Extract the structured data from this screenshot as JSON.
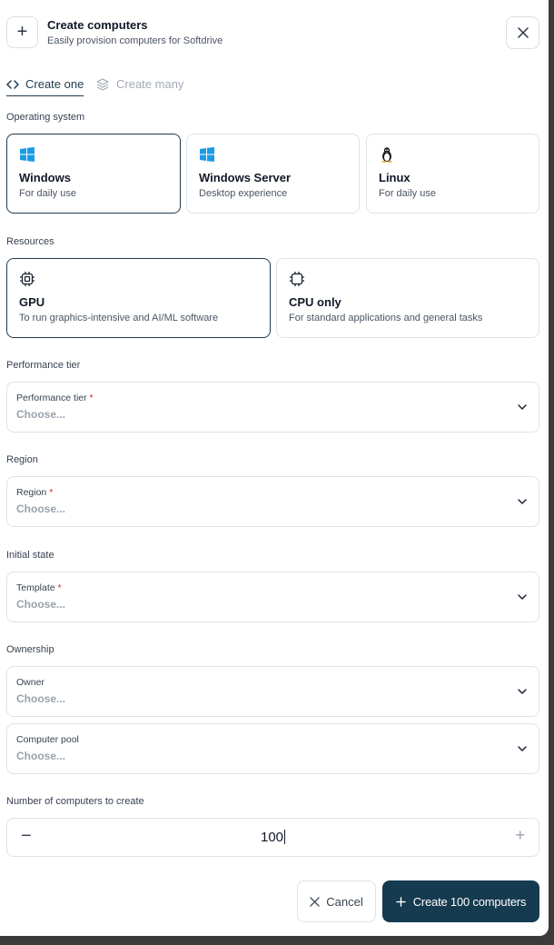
{
  "header": {
    "title": "Create computers",
    "subtitle": "Easily provision computers for Softdrive"
  },
  "tabs": [
    {
      "label": "Create one",
      "active": true
    },
    {
      "label": "Create many",
      "active": false
    }
  ],
  "os": {
    "label": "Operating system",
    "options": [
      {
        "title": "Windows",
        "subtitle": "For daily use",
        "icon": "windows-icon",
        "selected": true
      },
      {
        "title": "Windows Server",
        "subtitle": "Desktop experience",
        "icon": "windows-icon",
        "selected": false
      },
      {
        "title": "Linux",
        "subtitle": "For daily use",
        "icon": "linux-icon",
        "selected": false
      }
    ]
  },
  "resources": {
    "label": "Resources",
    "options": [
      {
        "title": "GPU",
        "subtitle": "To run graphics-intensive and AI/ML software",
        "icon": "gpu-chip-icon",
        "selected": true
      },
      {
        "title": "CPU only",
        "subtitle": "For standard applications and general tasks",
        "icon": "cpu-chip-icon",
        "selected": false
      }
    ]
  },
  "performance": {
    "section": "Performance tier",
    "field_label": "Performance tier",
    "required_mark": "*",
    "placeholder": "Choose..."
  },
  "region": {
    "section": "Region",
    "field_label": "Region",
    "required_mark": "*",
    "placeholder": "Choose..."
  },
  "initial_state": {
    "section": "Initial state",
    "field_label": "Template",
    "required_mark": "*",
    "placeholder": "Choose..."
  },
  "ownership": {
    "section": "Ownership",
    "owner_label": "Owner",
    "owner_placeholder": "Choose...",
    "pool_label": "Computer pool",
    "pool_placeholder": "Choose..."
  },
  "count": {
    "section": "Number of computers to create",
    "value": "100",
    "minus": "−",
    "plus": "+"
  },
  "actions": {
    "cancel": "Cancel",
    "create": "Create 100 computers"
  },
  "colors": {
    "accent": "#163a4f",
    "windows_blue": "#1a9be6",
    "required": "#dc2626"
  }
}
